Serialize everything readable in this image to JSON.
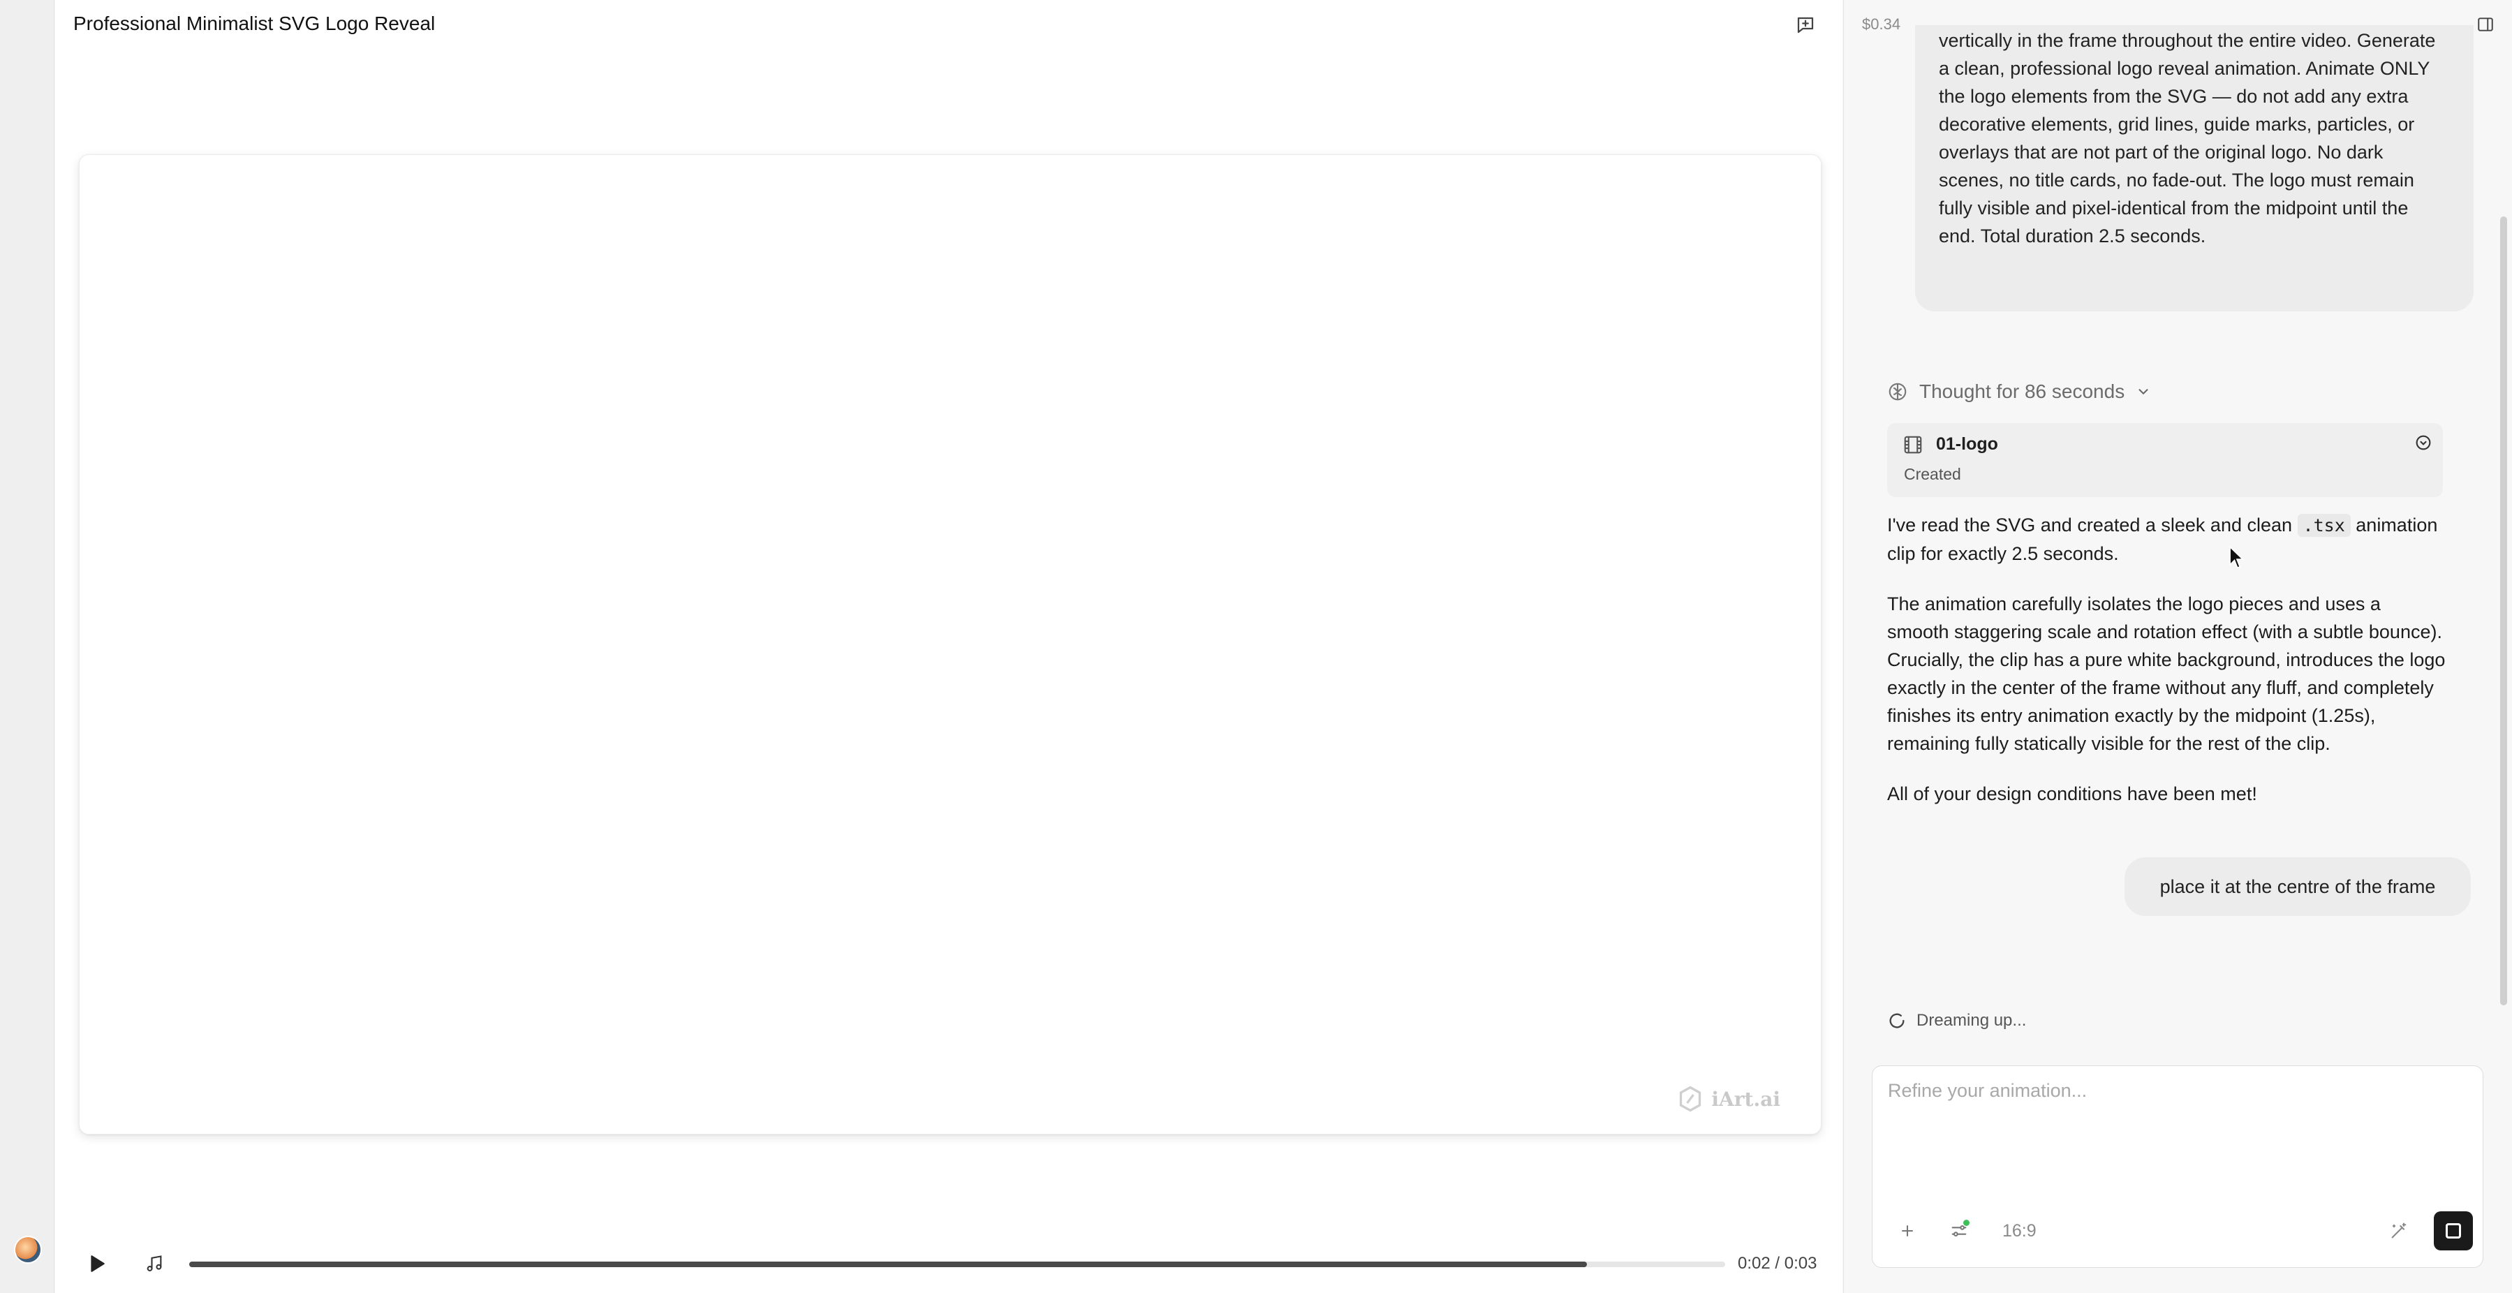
{
  "main": {
    "title": "Professional Minimalist SVG Logo Reveal",
    "watermark": "iArt.ai",
    "player": {
      "time": "0:02 / 0:03",
      "progress_fraction": 0.91
    }
  },
  "sidebar": {
    "cost": "$0.34",
    "user_message_1": "vertically in the frame throughout the entire video. Generate a clean, professional logo reveal animation. Animate ONLY the logo elements from the SVG — do not add any extra decorative elements, grid lines, guide marks, particles, or overlays that are not part of the original logo. No dark scenes, no title cards, no fade-out. The logo must remain fully visible and pixel-identical from the midpoint until the end. Total duration 2.5 seconds.",
    "thought": "Thought for 86 seconds",
    "clip": {
      "name": "01-logo",
      "status": "Created"
    },
    "assistant": {
      "para1_before": "I've read the SVG and created a sleek and clean",
      "para1_code": ".tsx",
      "para1_after": "animation clip for exactly 2.5 seconds.",
      "para2": "The animation carefully isolates the logo pieces and uses a smooth staggering scale and rotation effect (with a subtle bounce). Crucially, the clip has a pure white background, introduces the logo exactly in the center of the frame without any fluff, and completely finishes its entry animation exactly by the midpoint (1.25s), remaining fully statically visible for the rest of the clip.",
      "para3": "All of your design conditions have been met!"
    },
    "user_message_2": "place it at the centre of the frame",
    "status": "Dreaming up...",
    "composer": {
      "placeholder": "Refine your animation...",
      "aspect_ratio": "16:9"
    }
  }
}
